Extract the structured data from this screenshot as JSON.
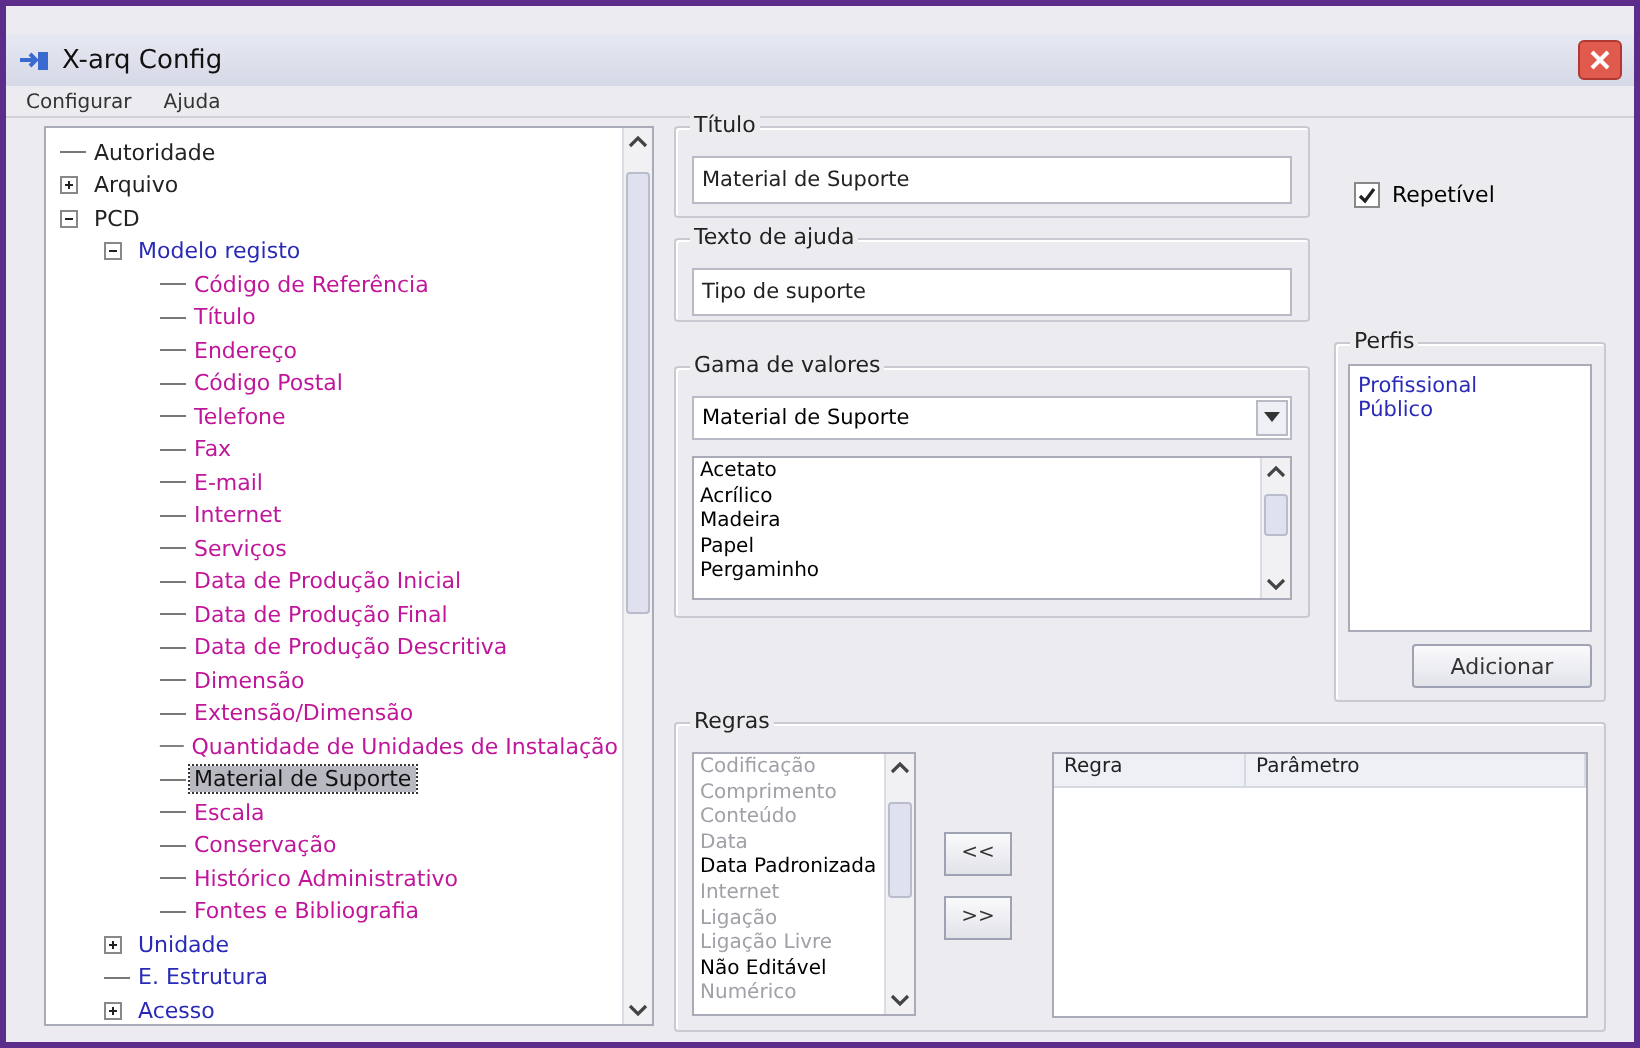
{
  "window": {
    "title": "X-arq Config"
  },
  "menu": [
    "Configurar",
    "Ajuda"
  ],
  "tree": [
    {
      "label": "Autoridade",
      "selected": false
    },
    {
      "label": "Arquivo",
      "selected": false,
      "expanded": false
    },
    {
      "label": "PCD",
      "selected": false,
      "expanded": true,
      "children": [
        {
          "label": "Modelo registo",
          "selected": false,
          "expanded": true,
          "children": [
            {
              "label": "Código de Referência",
              "selected": false
            },
            {
              "label": "Título",
              "selected": false
            },
            {
              "label": "Endereço",
              "selected": false
            },
            {
              "label": "Código Postal",
              "selected": false
            },
            {
              "label": "Telefone",
              "selected": false
            },
            {
              "label": "Fax",
              "selected": false
            },
            {
              "label": "E-mail",
              "selected": false
            },
            {
              "label": "Internet",
              "selected": false
            },
            {
              "label": "Serviços",
              "selected": false
            },
            {
              "label": "Data de Produção Inicial",
              "selected": false
            },
            {
              "label": "Data de Produção Final",
              "selected": false
            },
            {
              "label": "Data de Produção Descritiva",
              "selected": false
            },
            {
              "label": "Dimensão",
              "selected": false
            },
            {
              "label": "Extensão/Dimensão",
              "selected": false
            },
            {
              "label": "Quantidade de Unidades de Instalação",
              "selected": false
            },
            {
              "label": "Material de Suporte",
              "selected": true
            },
            {
              "label": "Escala",
              "selected": false
            },
            {
              "label": "Conservação",
              "selected": false
            },
            {
              "label": "Histórico Administrativo",
              "selected": false
            },
            {
              "label": "Fontes e Bibliografia",
              "selected": false
            }
          ]
        },
        {
          "label": "Unidade",
          "selected": false,
          "expanded": false
        },
        {
          "label": "E. Estrutura",
          "selected": false
        },
        {
          "label": "Acesso",
          "selected": false,
          "expanded": false
        }
      ]
    }
  ],
  "titulo": {
    "label": "Título",
    "value": "Material de Suporte"
  },
  "texto_ajuda": {
    "label": "Texto de ajuda",
    "value": "Tipo de suporte"
  },
  "repetivel": {
    "label": "Repetível",
    "checked": true
  },
  "gama": {
    "label": "Gama de valores",
    "combo_value": "Material de Suporte",
    "values": [
      "Acetato",
      "Acrílico",
      "Madeira",
      "Papel",
      "Pergaminho"
    ]
  },
  "perfis": {
    "label": "Perfis",
    "items": [
      "Profissional",
      "Público"
    ],
    "button": "Adicionar"
  },
  "regras": {
    "label": "Regras",
    "items": [
      {
        "label": "Codificação",
        "disabled": true
      },
      {
        "label": "Comprimento",
        "disabled": true
      },
      {
        "label": "Conteúdo",
        "disabled": true
      },
      {
        "label": "Data",
        "disabled": true
      },
      {
        "label": "Data Padronizada",
        "disabled": false
      },
      {
        "label": "Internet",
        "disabled": true
      },
      {
        "label": "Ligação",
        "disabled": true
      },
      {
        "label": "Ligação Livre",
        "disabled": true
      },
      {
        "label": "Não Editável",
        "disabled": false
      },
      {
        "label": "Numérico",
        "disabled": true
      }
    ],
    "buttons": [
      "<<",
      ">>"
    ],
    "columns": [
      "Regra",
      "Parâmetro"
    ]
  }
}
